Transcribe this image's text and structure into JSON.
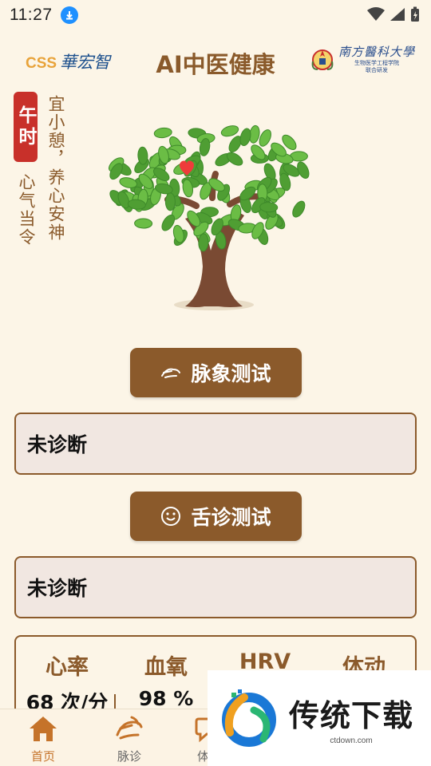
{
  "status": {
    "time": "11:27"
  },
  "header": {
    "left_logo_css": "CSS",
    "left_logo_cn": "華宏智",
    "title": "AI中医健康",
    "univ_name": "南方醫科大學",
    "univ_sub1": "生物医学工程学院",
    "univ_sub2": "联合研发"
  },
  "time_panel": {
    "badge": "午时",
    "advice": "宜小憩，养心安神",
    "meridian": "心气当令"
  },
  "pulse_test": {
    "button_label": "脉象测试",
    "result": "未诊断"
  },
  "tongue_test": {
    "button_label": "舌诊测试",
    "result": "未诊断"
  },
  "vitals": [
    {
      "label": "心率",
      "value": "68 次/分"
    },
    {
      "label": "血氧",
      "value": "98 %"
    },
    {
      "label": "HRV",
      "value": ""
    },
    {
      "label": "体动",
      "value": ""
    }
  ],
  "nav": {
    "items": [
      {
        "label": "首页",
        "icon": "home-icon"
      },
      {
        "label": "脉诊",
        "icon": "pulse-hand-icon"
      },
      {
        "label": "体质",
        "icon": "chat-icon"
      }
    ]
  },
  "watermark": {
    "title": "传统下载",
    "url": "ctdown.com"
  },
  "colors": {
    "brown": "#8b5a2b",
    "red": "#c8302a",
    "bg": "#fcf5e7",
    "active": "#c5732a"
  }
}
